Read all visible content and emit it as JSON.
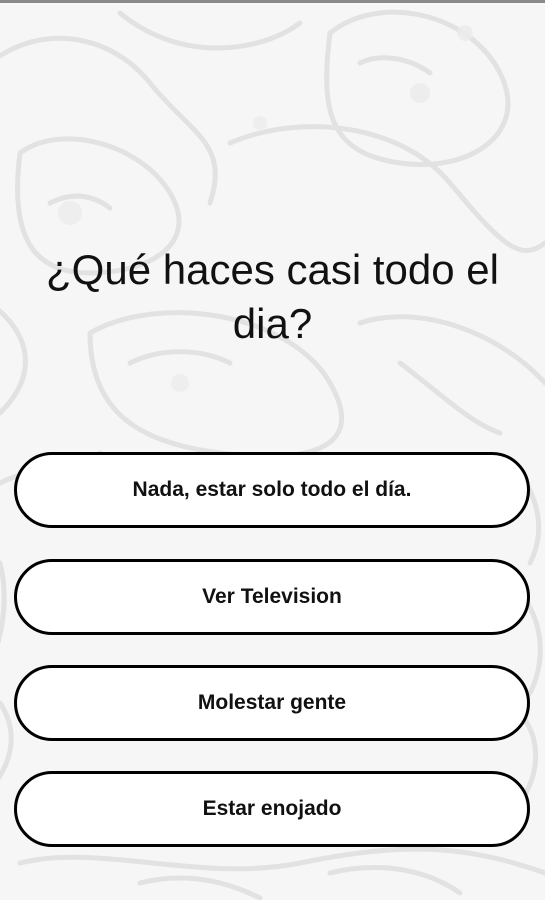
{
  "quiz": {
    "question": "¿Qué haces casi todo el dia?",
    "answers": [
      {
        "label": "Nada, estar solo todo el día."
      },
      {
        "label": "Ver Television"
      },
      {
        "label": "Molestar gente"
      },
      {
        "label": "Estar enojado"
      }
    ]
  },
  "colors": {
    "background": "#f6f6f6",
    "button_fill": "#ffffff",
    "button_border": "#000000",
    "text": "#111111"
  }
}
